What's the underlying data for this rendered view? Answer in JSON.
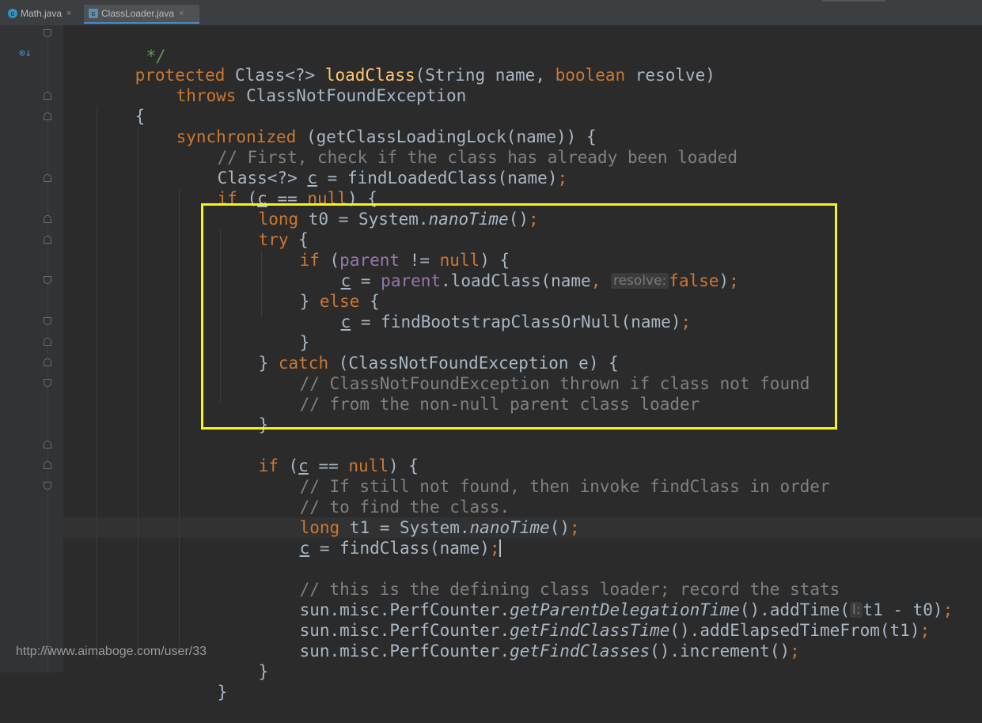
{
  "tabs": [
    {
      "label": "Math.java",
      "icon": "class-file-icon",
      "active": false,
      "close": "×"
    },
    {
      "label": "ClassLoader.java",
      "icon": "library-class-icon",
      "active": true,
      "close": "×"
    }
  ],
  "editor": {
    "lines": {
      "l00": [
        "*/"
      ],
      "l01": [
        "protected",
        " Class<?> ",
        "loadClass",
        "(String name, ",
        "boolean",
        " resolve)"
      ],
      "l02": [
        "throws",
        " ClassNotFoundException"
      ],
      "l03": [
        "{"
      ],
      "l04": [
        "synchronized",
        " (getClassLoadingLock(name)) {"
      ],
      "l05": [
        "// First, check if the class has already been loaded"
      ],
      "l06": [
        "Class<?> ",
        "c",
        " = findLoadedClass(name)",
        ";"
      ],
      "l07": [
        "if",
        " (",
        "c",
        " == ",
        "null",
        ") {"
      ],
      "l08": [
        "long",
        " t0 = System.",
        "nanoTime",
        "()",
        ";"
      ],
      "l09": [
        "try",
        " {"
      ],
      "l10": [
        "if",
        " (",
        "parent",
        " != ",
        "null",
        ") {"
      ],
      "l11": [
        "c",
        " = ",
        "parent",
        ".loadClass(name",
        ", ",
        "resolve:",
        "false",
        ")",
        ";"
      ],
      "l12": [
        "}",
        " else",
        " {"
      ],
      "l13": [
        "c",
        " = findBootstrapClassOrNull(name)",
        ";"
      ],
      "l14": [
        "}"
      ],
      "l15": [
        "} ",
        "catch",
        " (ClassNotFoundException e) {"
      ],
      "l16": [
        "// ClassNotFoundException thrown if class not found"
      ],
      "l17": [
        "// from the non-null parent class loader"
      ],
      "l18": [
        "}"
      ],
      "l20": [
        "if",
        " (",
        "c",
        " == ",
        "null",
        ") {"
      ],
      "l21": [
        "// If still not found, then invoke findClass in order"
      ],
      "l22": [
        "// to find the class."
      ],
      "l23": [
        "long",
        " t1 = System.",
        "nanoTime",
        "()",
        ";"
      ],
      "l24": [
        "c",
        " = findClass(name)",
        ";"
      ],
      "l26": [
        "// this is the defining class loader; record the stats"
      ],
      "l27": [
        "sun.misc.PerfCounter.",
        "getParentDelegationTime",
        "().addTime(",
        "l:",
        "t1 - t0)",
        ";"
      ],
      "l28": [
        "sun.misc.PerfCounter.",
        "getFindClassTime",
        "().addElapsedTimeFrom(t1)",
        ";"
      ],
      "l29": [
        "sun.misc.PerfCounter.",
        "getFindClasses",
        "().increment()",
        ";"
      ],
      "l30": [
        "}"
      ],
      "l31": [
        "}"
      ]
    },
    "gutter": {
      "override_icon": "override-method-icon"
    }
  },
  "highlight": {
    "color": "#f7f31e"
  },
  "watermark": "http://www.aimaboge.com/user/33"
}
